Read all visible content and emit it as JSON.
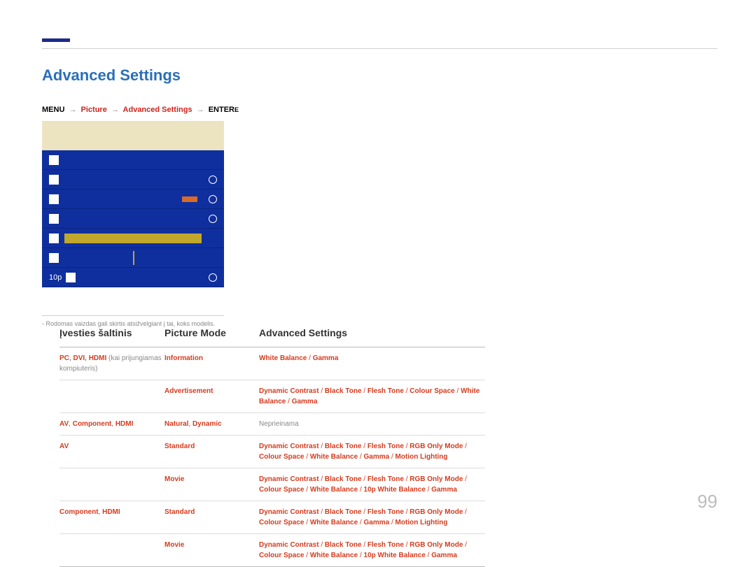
{
  "page_title": "Advanced Settings",
  "breadcrumb": {
    "menu": "MENU",
    "arrow": "→",
    "picture": "Picture",
    "advanced": "Advanced Settings",
    "enter": "ENTER",
    "enter_icon": "E"
  },
  "menu": {
    "items": [
      {
        "left": "",
        "right_label": ""
      },
      {
        "left": ""
      },
      {
        "left": ""
      },
      {
        "left": ""
      },
      {
        "left": "",
        "right_label": ""
      },
      {
        "left": ""
      },
      {
        "left": "10p"
      }
    ]
  },
  "footnote": "-  Rodomas vaizdas gali skirtis atsižvelgiant į tai, koks modelis.",
  "table": {
    "headers": {
      "a": "Įvesties šaltinis",
      "b": "Picture Mode",
      "c": "Advanced Settings"
    },
    "rows": [
      {
        "a_html": "<span class='red'>PC</span><span class='plain'>, </span><span class='red'>DVI</span><span class='plain'>, </span><span class='red'>HDMI</span><span class='gray'> (kai prijungiamas kompiuteris)</span>",
        "b_html": "<span class='red'>Information</span>",
        "c_html": "<span class='red'>White Balance</span><span class='red-n'> / </span><span class='red'>Gamma</span>",
        "sub": [
          {
            "b_html": "<span class='red'>Advertisement</span>",
            "c_html": "<span class='red'>Dynamic Contrast</span><span class='red-n'> / </span><span class='red'>Black Tone</span><span class='red-n'> / </span><span class='red'>Flesh Tone</span><span class='red-n'> / </span><span class='red'>Colour Space</span><span class='red-n'> / </span><span class='red'>White Balance</span><span class='red-n'> / </span><span class='red'>Gamma</span>"
          }
        ]
      },
      {
        "a_html": "<span class='red'>AV</span><span class='red-n'>, </span><span class='red'>Component</span><span class='red-n'>, </span><span class='red'>HDMI</span>",
        "b_html": "<span class='red'>Natural</span><span class='red-n'>, </span><span class='red'>Dynamic</span>",
        "c_html": "<span class='gray'>Neprieinama</span>"
      },
      {
        "a_html": "<span class='red'>AV</span>",
        "b_html": "<span class='red'>Standard</span>",
        "c_html": "<span class='red'>Dynamic Contrast</span><span class='red-n'> / </span><span class='red'>Black Tone</span><span class='red-n'> / </span><span class='red'>Flesh Tone</span><span class='red-n'> / </span><span class='red'>RGB Only Mode</span><span class='red-n'> / </span><span class='red'>Colour Space</span><span class='red-n'> / </span><span class='red'>White Balance</span><span class='red-n'> / </span><span class='red'>Gamma</span><span class='red-n'> / </span><span class='red'>Motion Lighting</span>",
        "sub": [
          {
            "b_html": "<span class='red'>Movie</span>",
            "c_html": "<span class='red'>Dynamic Contrast</span><span class='red-n'> / </span><span class='red'>Black Tone</span><span class='red-n'> / </span><span class='red'>Flesh Tone</span><span class='red-n'> / </span><span class='red'>RGB Only Mode</span><span class='red-n'> / </span><span class='red'>Colour Space</span><span class='red-n'> / </span><span class='red'>White Balance</span><span class='red-n'> / </span><span class='red'>10p White Balance</span><span class='red-n'> / </span><span class='red'>Gamma</span>"
          }
        ]
      },
      {
        "a_html": "<span class='red'>Component</span><span class='red-n'>, </span><span class='red'>HDMI</span>",
        "b_html": "<span class='red'>Standard</span>",
        "c_html": "<span class='red'>Dynamic Contrast</span><span class='red-n'> / </span><span class='red'>Black Tone</span><span class='red-n'> / </span><span class='red'>Flesh Tone</span><span class='red-n'> / </span><span class='red'>RGB Only Mode</span><span class='red-n'> / </span><span class='red'>Colour Space</span><span class='red-n'> / </span><span class='red'>White Balance</span><span class='red-n'> / </span><span class='red'>Gamma</span><span class='red-n'> / </span><span class='red'>Motion Lighting</span>",
        "sub": [
          {
            "b_html": "<span class='red'>Movie</span>",
            "c_html": "<span class='red'>Dynamic Contrast</span><span class='red-n'> / </span><span class='red'>Black Tone</span><span class='red-n'> / </span><span class='red'>Flesh Tone</span><span class='red-n'> / </span><span class='red'>RGB Only Mode</span><span class='red-n'> / </span><span class='red'>Colour Space</span><span class='red-n'> / </span><span class='red'>White Balance</span><span class='red-n'> / </span><span class='red'>10p White Balance</span><span class='red-n'> / </span><span class='red'>Gamma</span>"
          }
        ]
      }
    ]
  },
  "page_number": "99"
}
